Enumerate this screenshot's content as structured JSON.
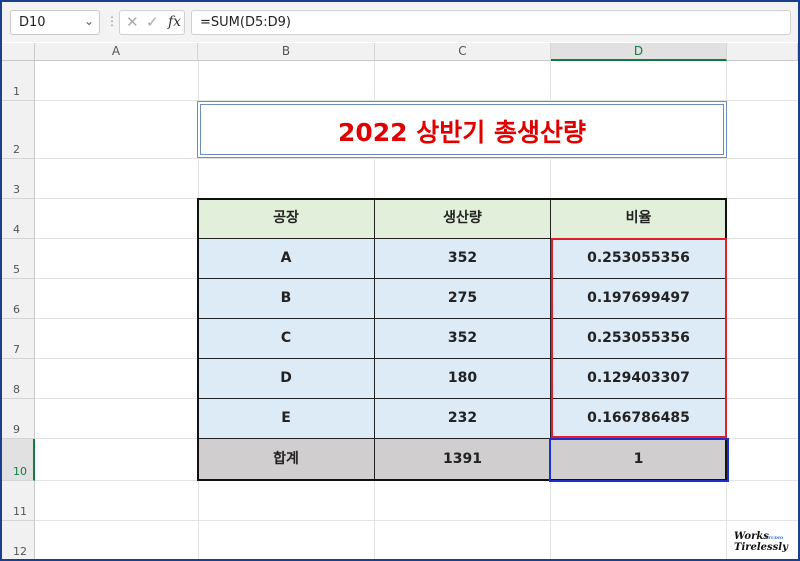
{
  "formula_bar": {
    "name_box": "D10",
    "more_glyph": "⋮",
    "cancel_glyph": "✕",
    "enter_glyph": "✓",
    "fx_label": "fx",
    "formula": "=SUM(D5:D9)"
  },
  "columns": [
    "A",
    "B",
    "C",
    "D"
  ],
  "selected_column": "D",
  "rows": [
    "1",
    "2",
    "3",
    "4",
    "5",
    "6",
    "7",
    "8",
    "9",
    "10",
    "11",
    "12"
  ],
  "selected_row": "10",
  "title": "2022 상반기 총생산량",
  "table": {
    "headers": [
      "공장",
      "생산량",
      "비율"
    ],
    "rows": [
      [
        "A",
        "352",
        "0.253055356"
      ],
      [
        "B",
        "275",
        "0.197699497"
      ],
      [
        "C",
        "352",
        "0.253055356"
      ],
      [
        "D",
        "180",
        "0.129403307"
      ],
      [
        "E",
        "232",
        "0.166786485"
      ]
    ],
    "total": [
      "합계",
      "1391",
      "1"
    ]
  },
  "colors": {
    "title": "#e00000",
    "header_fill": "#e2efda",
    "body_fill": "#ddebf7",
    "total_fill": "#d0cece",
    "highlight_red": "#e0202a",
    "selection_blue": "#1f2fcf",
    "excel_green": "#107c41"
  },
  "watermark": {
    "line1": "Works",
    "line2": "Tirelessly",
    "small": "STUDIO"
  }
}
